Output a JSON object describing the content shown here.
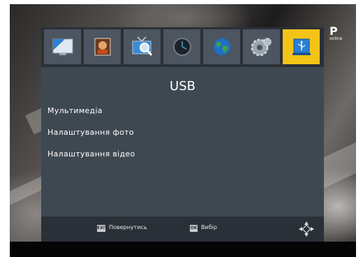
{
  "title": "USB",
  "menu": [
    "Мультимедіа",
    "Налаштування фото",
    "Налаштування відео"
  ],
  "tabs": [
    {
      "icon": "picture-settings-icon"
    },
    {
      "icon": "image-search-icon"
    },
    {
      "icon": "channel-search-icon"
    },
    {
      "icon": "clock-icon"
    },
    {
      "icon": "globe-icon"
    },
    {
      "icon": "system-gear-icon"
    },
    {
      "icon": "usb-icon",
      "active": true
    }
  ],
  "footer": {
    "exit_key": "EXIT",
    "exit_label": "Повернутись",
    "ok_key": "OK",
    "ok_label": "Вибір"
  },
  "corner_logo": {
    "mark": "P",
    "tag": "online"
  },
  "colors": {
    "panel": "#3e4851",
    "bar": "#2a3037",
    "active_tab": "#f3c417"
  }
}
